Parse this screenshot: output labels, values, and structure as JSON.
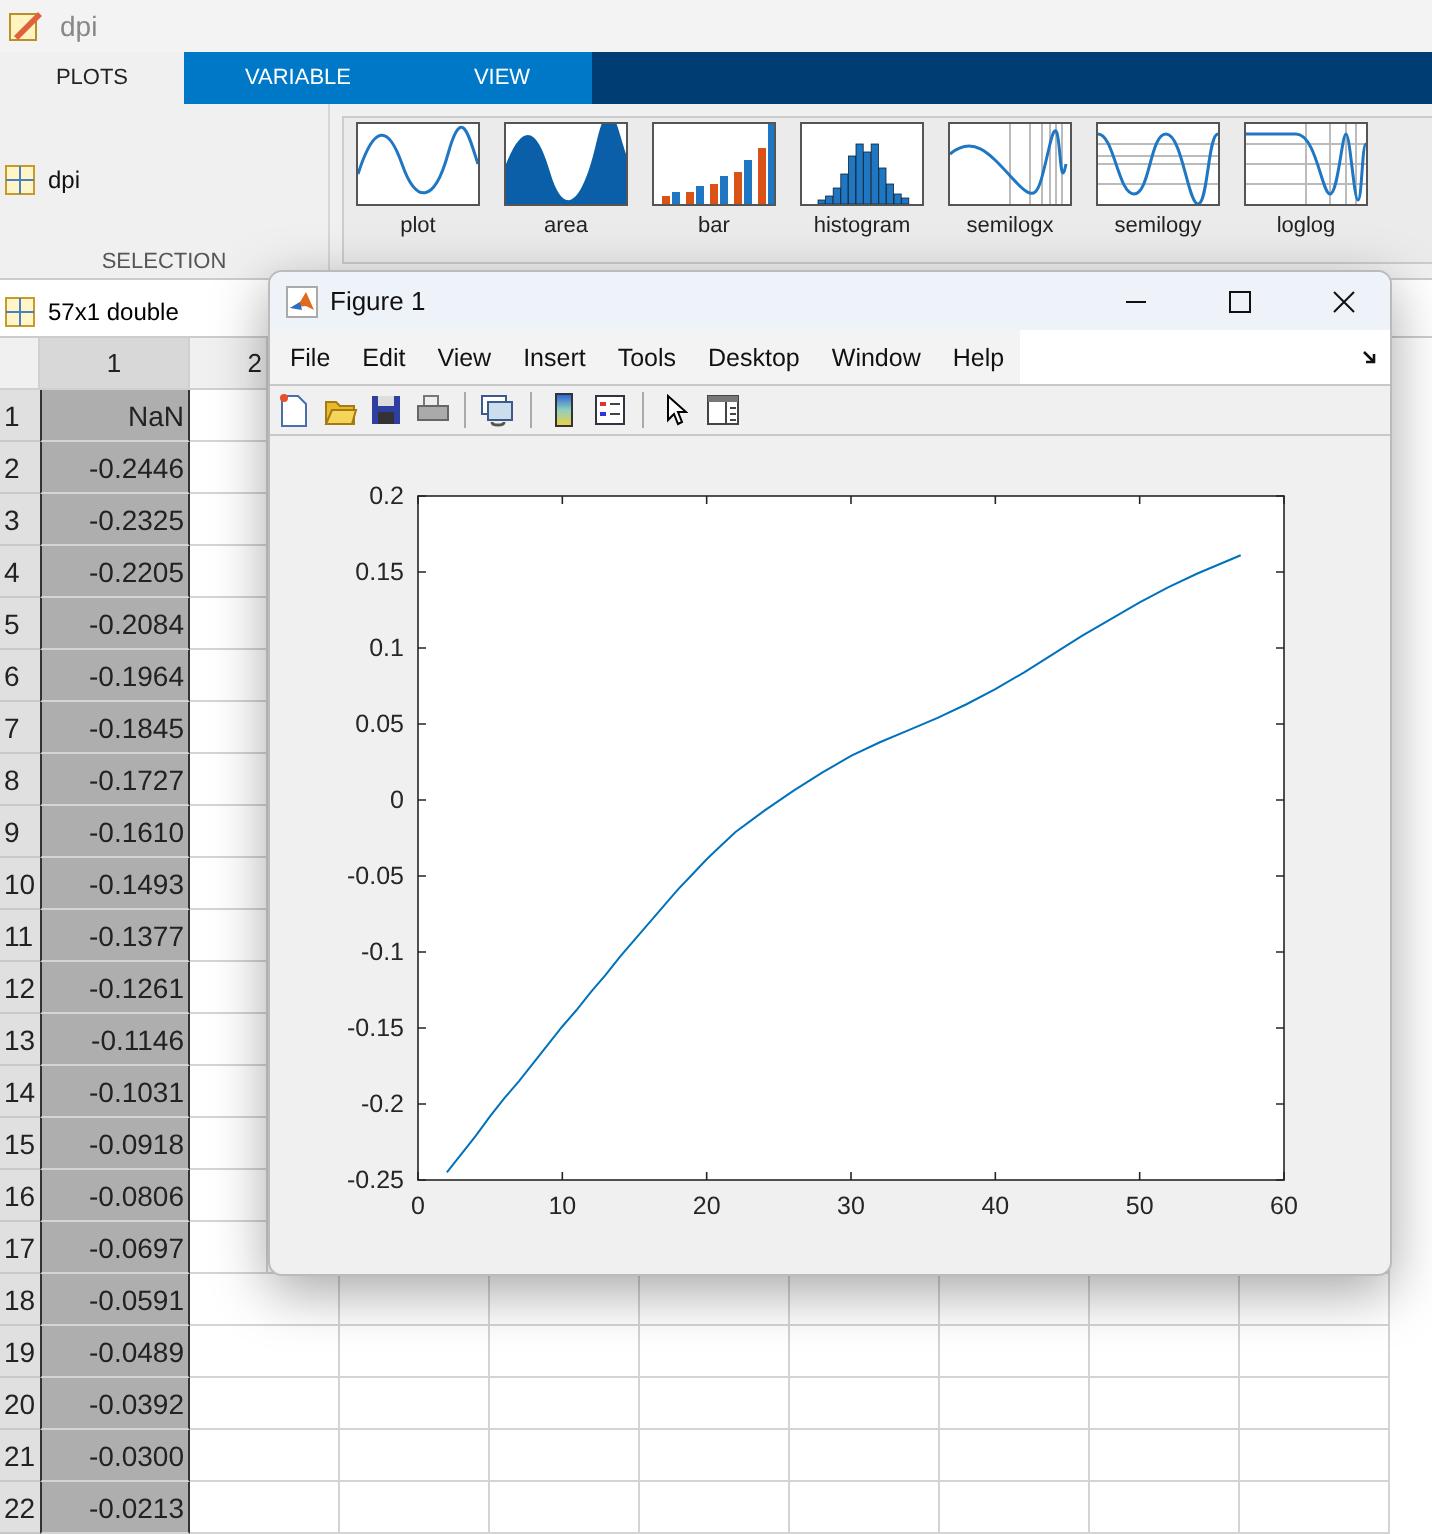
{
  "window": {
    "title": "dpi"
  },
  "tabs": [
    {
      "label": "PLOTS",
      "selected": true
    },
    {
      "label": "VARIABLE",
      "selected": false
    },
    {
      "label": "VIEW",
      "selected": false
    }
  ],
  "selection": {
    "variable": "dpi",
    "section_label": "SELECTION"
  },
  "gallery": [
    {
      "kind": "plot",
      "label": "plot"
    },
    {
      "kind": "area",
      "label": "area"
    },
    {
      "kind": "bar",
      "label": "bar"
    },
    {
      "kind": "histogram",
      "label": "histogram"
    },
    {
      "kind": "semilogx",
      "label": "semilogx"
    },
    {
      "kind": "semilogy",
      "label": "semilogy"
    },
    {
      "kind": "loglog",
      "label": "loglog"
    }
  ],
  "variable_tab": {
    "label": "57x1 double"
  },
  "table": {
    "columns": [
      {
        "label": "1",
        "selected": true
      },
      {
        "label": "2",
        "selected": false
      }
    ],
    "rows": [
      {
        "index": "1",
        "value": "NaN"
      },
      {
        "index": "2",
        "value": "-0.2446"
      },
      {
        "index": "3",
        "value": "-0.2325"
      },
      {
        "index": "4",
        "value": "-0.2205"
      },
      {
        "index": "5",
        "value": "-0.2084"
      },
      {
        "index": "6",
        "value": "-0.1964"
      },
      {
        "index": "7",
        "value": "-0.1845"
      },
      {
        "index": "8",
        "value": "-0.1727"
      },
      {
        "index": "9",
        "value": "-0.1610"
      },
      {
        "index": "10",
        "value": "-0.1493"
      },
      {
        "index": "11",
        "value": "-0.1377"
      },
      {
        "index": "12",
        "value": "-0.1261"
      },
      {
        "index": "13",
        "value": "-0.1146"
      },
      {
        "index": "14",
        "value": "-0.1031"
      },
      {
        "index": "15",
        "value": "-0.0918"
      },
      {
        "index": "16",
        "value": "-0.0806"
      },
      {
        "index": "17",
        "value": "-0.0697"
      },
      {
        "index": "18",
        "value": "-0.0591"
      },
      {
        "index": "19",
        "value": "-0.0489"
      },
      {
        "index": "20",
        "value": "-0.0392"
      },
      {
        "index": "21",
        "value": "-0.0300"
      },
      {
        "index": "22",
        "value": "-0.0213"
      }
    ]
  },
  "figure": {
    "title": "Figure 1",
    "menu": [
      "File",
      "Edit",
      "View",
      "Insert",
      "Tools",
      "Desktop",
      "Window",
      "Help"
    ],
    "toolbar": [
      {
        "kind": "new"
      },
      {
        "kind": "open"
      },
      {
        "kind": "save"
      },
      {
        "kind": "print"
      },
      {
        "kind": "separator"
      },
      {
        "kind": "link"
      },
      {
        "kind": "separator"
      },
      {
        "kind": "colorbar"
      },
      {
        "kind": "legend"
      },
      {
        "kind": "separator"
      },
      {
        "kind": "pointer"
      },
      {
        "kind": "property"
      }
    ],
    "chart_data": {
      "type": "line",
      "xlim": [
        0,
        60
      ],
      "ylim": [
        -0.25,
        0.2
      ],
      "xticks": [
        0,
        10,
        20,
        30,
        40,
        50,
        60
      ],
      "yticks": [
        -0.25,
        -0.2,
        -0.15,
        -0.1,
        -0.05,
        0,
        0.05,
        0.1,
        0.15,
        0.2
      ],
      "x": [
        2,
        3,
        4,
        5,
        6,
        7,
        8,
        9,
        10,
        11,
        12,
        13,
        14,
        15,
        16,
        17,
        18,
        19,
        20,
        21,
        22,
        24,
        26,
        28,
        30,
        32,
        34,
        36,
        38,
        40,
        42,
        44,
        46,
        48,
        50,
        52,
        54,
        57
      ],
      "series": [
        {
          "color": "#0072bd",
          "values": [
            -0.245,
            -0.233,
            -0.221,
            -0.208,
            -0.196,
            -0.185,
            -0.173,
            -0.161,
            -0.149,
            -0.138,
            -0.126,
            -0.115,
            -0.103,
            -0.092,
            -0.081,
            -0.07,
            -0.059,
            -0.049,
            -0.039,
            -0.03,
            -0.021,
            -0.007,
            0.006,
            0.018,
            0.029,
            0.038,
            0.046,
            0.054,
            0.063,
            0.073,
            0.084,
            0.096,
            0.108,
            0.119,
            0.13,
            0.14,
            0.149,
            0.161
          ]
        }
      ]
    }
  }
}
